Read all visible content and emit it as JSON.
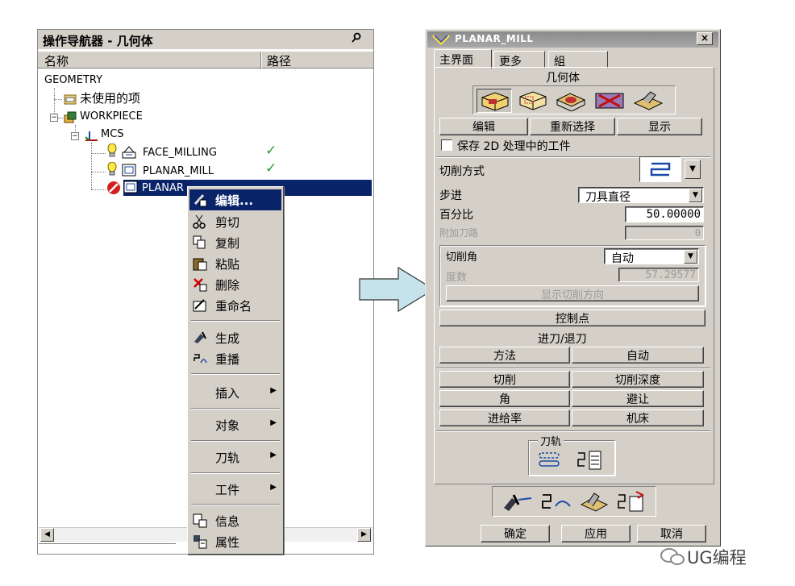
{
  "navigator": {
    "title": "操作导航器 - 几何体",
    "columns": [
      "名称",
      "路径"
    ],
    "tree": {
      "root": "GEOMETRY",
      "unused": "未使用的项",
      "workpiece": "WORKPIECE",
      "mcs": "MCS",
      "op1": "FACE_MILLING",
      "op2": "PLANAR_MILL",
      "op3": "PLANAR",
      "check": "✓"
    }
  },
  "context_menu": {
    "items": [
      {
        "label": "编辑...",
        "icon": "edit-icon"
      },
      {
        "label": "剪切",
        "icon": "scissors-icon"
      },
      {
        "label": "复制",
        "icon": "copy-icon"
      },
      {
        "label": "粘贴",
        "icon": "paste-icon"
      },
      {
        "label": "删除",
        "icon": "delete-icon"
      },
      {
        "label": "重命名",
        "icon": "rename-icon"
      },
      {
        "label": "生成",
        "icon": "generate-icon"
      },
      {
        "label": "重播",
        "icon": "replay-icon"
      },
      {
        "label": "插入",
        "submenu": true
      },
      {
        "label": "对象",
        "submenu": true
      },
      {
        "label": "刀轨",
        "submenu": true
      },
      {
        "label": "工件",
        "submenu": true
      },
      {
        "label": "信息",
        "icon": "info-icon"
      },
      {
        "label": "属性",
        "icon": "properties-icon"
      }
    ]
  },
  "dialog": {
    "title": "PLANAR_MILL",
    "close": "×",
    "tabs": [
      "主界面",
      "更多",
      "組"
    ],
    "geometry_label": "几何体",
    "geo_buttons": [
      "编辑",
      "重新选择",
      "显示"
    ],
    "save_2d": "保存 2D 处理中的工件",
    "cut_method_label": "切削方式",
    "stepover_label": "步进",
    "stepover_value": "刀具直径",
    "percent_label": "百分比",
    "percent_value": "50.00000",
    "extra_passes_label": "附加刀路",
    "extra_passes_value": "0",
    "cut_angle_label": "切削角",
    "cut_angle_value": "自动",
    "degrees_label": "度数",
    "degrees_value": "57.29577",
    "show_cut_dir": "显示切削方向",
    "control_points": "控制点",
    "engage_retract": "进刀/退刀",
    "method": "方法",
    "auto": "自动",
    "grid_buttons": [
      "切削",
      "切削深度",
      "角",
      "避让",
      "进给率",
      "机床"
    ],
    "toolpath_label": "刀轨",
    "ok": "确定",
    "apply": "应用",
    "cancel": "取消"
  },
  "watermark": "UG编程",
  "colors": {
    "selection": "#0a246a",
    "dialog_bg": "#d4d0c8",
    "arrow_fill": "#c6e2ea"
  }
}
